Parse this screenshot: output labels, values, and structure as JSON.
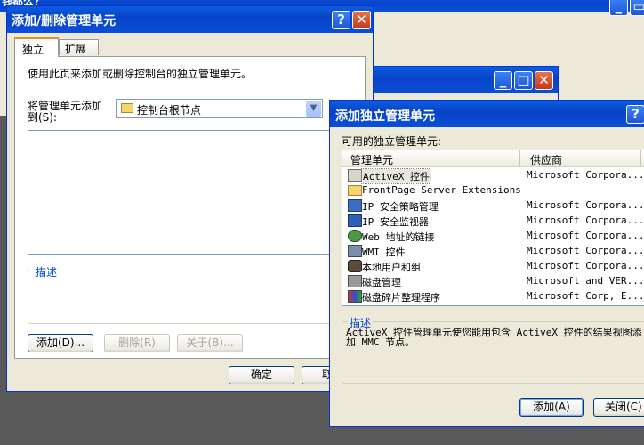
{
  "background_window": {
    "title": "钱都么？"
  },
  "add_remove_dialog": {
    "title": "添加/删除管理单元",
    "tabs": [
      {
        "label": "独立",
        "active": true
      },
      {
        "label": "扩展",
        "active": false
      }
    ],
    "instruction": "使用此页来添加或删除控制台的独立管理单元。",
    "add_to_label_line1": "将管理单元添加",
    "add_to_label_line2": "到(S):",
    "add_to_value": "控制台根节点",
    "description_title": "描述",
    "buttons": {
      "add": "添加(D)...",
      "remove": "删除(R)",
      "about": "关于(B)...",
      "ok": "确定",
      "cancel": "取"
    }
  },
  "standalone_dialog": {
    "title": "添加独立管理单元",
    "available_label": "可用的独立管理单元:",
    "columns": [
      "管理单元",
      "供应商"
    ],
    "rows": [
      {
        "name": "ActiveX 控件",
        "vendor": "Microsoft Corpora...",
        "icon": "activex-icon",
        "selected": true
      },
      {
        "name": "FrontPage Server Extensions",
        "vendor": "",
        "icon": "folder-icon"
      },
      {
        "name": "IP 安全策略管理",
        "vendor": "Microsoft Corpora...",
        "icon": "ip-security-policy-icon"
      },
      {
        "name": "IP 安全监视器",
        "vendor": "Microsoft Corpora...",
        "icon": "ip-security-monitor-icon"
      },
      {
        "name": "Web 地址的链接",
        "vendor": "Microsoft Corpora...",
        "icon": "web-link-icon"
      },
      {
        "name": "WMI 控件",
        "vendor": "Microsoft Corpora...",
        "icon": "wmi-control-icon"
      },
      {
        "name": "本地用户和组",
        "vendor": "Microsoft Corpora...",
        "icon": "local-users-icon"
      },
      {
        "name": "磁盘管理",
        "vendor": "Microsoft and VER...",
        "icon": "disk-management-icon"
      },
      {
        "name": "磁盘碎片整理程序",
        "vendor": "Microsoft Corp, E...",
        "icon": "defragmenter-icon"
      }
    ],
    "description_title": "描述",
    "description_text_line1": "ActiveX 控件管理单元使您能用包含 ActiveX 控件的结果视图添",
    "description_text_line2": "加 MMC 节点。",
    "buttons": {
      "add": "添加(A)",
      "close": "关闭(C)"
    }
  },
  "colors": {
    "titlebar": "#0a4fd8",
    "dialog_face": "#ece9d8",
    "desktop": "#5a5a5a",
    "group_title": "#0046d5"
  }
}
